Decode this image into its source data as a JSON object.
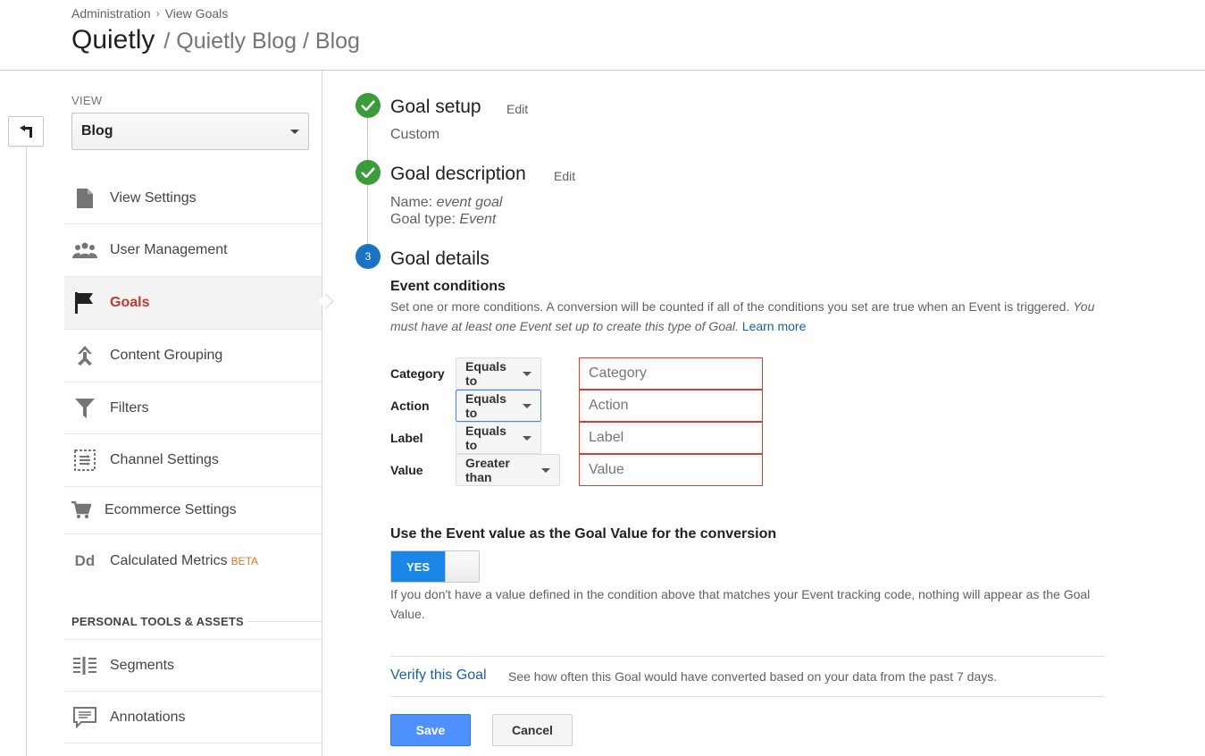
{
  "header": {
    "breadcrumb": [
      "Administration",
      "View Goals"
    ],
    "breadcrumb_sep": "›",
    "title": "Quietly",
    "subtitle": "/ Quietly Blog / Blog"
  },
  "sidebar": {
    "view_label": "VIEW",
    "view_value": "Blog",
    "items": [
      {
        "label": "View Settings",
        "icon": "document-icon"
      },
      {
        "label": "User Management",
        "icon": "people-icon"
      },
      {
        "label": "Goals",
        "icon": "flag-icon",
        "active": true
      },
      {
        "label": "Content Grouping",
        "icon": "content-grouping-icon"
      },
      {
        "label": "Filters",
        "icon": "filter-icon"
      },
      {
        "label": "Channel Settings",
        "icon": "channel-settings-icon"
      },
      {
        "label": "Ecommerce Settings",
        "icon": "cart-icon"
      },
      {
        "label": "Calculated Metrics",
        "icon": "dd-icon",
        "badge": "BETA"
      }
    ],
    "section_title": "PERSONAL TOOLS & ASSETS",
    "personal_items": [
      {
        "label": "Segments",
        "icon": "segments-icon"
      },
      {
        "label": "Annotations",
        "icon": "annotations-icon"
      }
    ]
  },
  "steps": {
    "setup": {
      "title": "Goal setup",
      "edit": "Edit",
      "value": "Custom"
    },
    "description": {
      "title": "Goal description",
      "edit": "Edit",
      "name_label": "Name:",
      "name_value": "event goal",
      "type_label": "Goal type:",
      "type_value": "Event"
    },
    "details": {
      "number": "3",
      "title": "Goal details"
    }
  },
  "event_conditions": {
    "title": "Event conditions",
    "desc": "Set one or more conditions. A conversion will be counted if all of the conditions you set are true when an Event is triggered.",
    "desc_italic": "You must have at least one Event set up to create this type of Goal.",
    "learn_more": "Learn more",
    "rows": [
      {
        "label": "Category",
        "operator": "Equals to",
        "placeholder": "Category"
      },
      {
        "label": "Action",
        "operator": "Equals to",
        "placeholder": "Action"
      },
      {
        "label": "Label",
        "operator": "Equals to",
        "placeholder": "Label"
      },
      {
        "label": "Value",
        "operator": "Greater than",
        "placeholder": "Value"
      }
    ]
  },
  "goal_value": {
    "title": "Use the Event value as the Goal Value for the conversion",
    "toggle": "YES",
    "note": "If you don't have a value defined in the condition above that matches your Event tracking code, nothing will appear as the Goal Value."
  },
  "verify": {
    "link": "Verify this Goal",
    "text": "See how often this Goal would have converted based on your data from the past 7 days."
  },
  "actions": {
    "save": "Save",
    "cancel": "Cancel"
  },
  "colors": {
    "accent": "#4d90fe",
    "active_nav": "#c0392b",
    "step_done": "#3a9b3a",
    "step_current": "#1a73c5",
    "input_error": "#d23f31"
  }
}
